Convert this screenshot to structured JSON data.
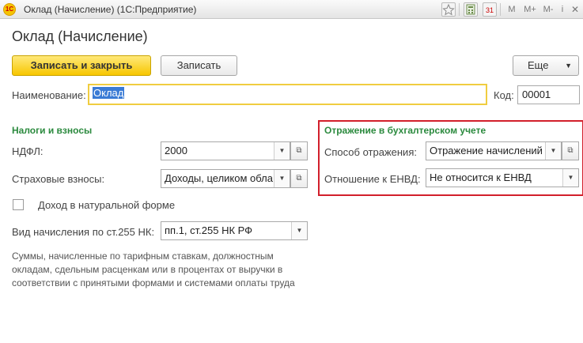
{
  "window": {
    "title": "Оклад (Начисление)  (1С:Предприятие)",
    "logo_text": "1С",
    "toolbar": {
      "m": "M",
      "m_plus": "M+",
      "m_minus": "M-",
      "calendar_day": "31"
    }
  },
  "form": {
    "title": "Оклад (Начисление)",
    "buttons": {
      "save_close": "Записать и закрыть",
      "save": "Записать",
      "more": "Еще"
    },
    "name": {
      "label": "Наименование:",
      "value": "Оклад"
    },
    "code": {
      "label": "Код:",
      "value": "00001"
    },
    "taxes": {
      "title": "Налоги и взносы",
      "ndfl": {
        "label": "НДФЛ:",
        "value": "2000"
      },
      "insurance": {
        "label": "Страховые взносы:",
        "value": "Доходы, целиком обла"
      }
    },
    "accounting": {
      "title": "Отражение в бухгалтерском учете",
      "method": {
        "label": "Способ отражения:",
        "value": "Отражение начислений"
      },
      "envd": {
        "label": "Отношение к ЕНВД:",
        "value": "Не относится к ЕНВД"
      }
    },
    "in_kind": {
      "label": "Доход в натуральной форме",
      "checked": false
    },
    "art255": {
      "label": "Вид начисления по ст.255 НК:",
      "value": "пп.1, ст.255 НК РФ"
    },
    "note": "Суммы, начисленные по тарифным ставкам, должностным окладам, сдельным расценкам или в процентах от выручки в соответствии с принятыми формами и системами оплаты труда"
  },
  "colors": {
    "accent_yellow": "#f7c600",
    "section_green": "#2b8a3e",
    "highlight_red": "#d21f2b"
  }
}
